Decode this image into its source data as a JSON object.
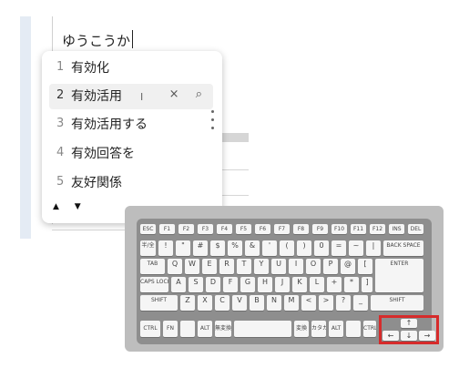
{
  "document": {
    "composition_text": "ゆうこうか"
  },
  "candidate_window": {
    "candidates": [
      {
        "number": "1",
        "text": "有効化"
      },
      {
        "number": "2",
        "text": "有効活用",
        "selected": true
      },
      {
        "number": "3",
        "text": "有効活用する"
      },
      {
        "number": "4",
        "text": "有効回答を"
      },
      {
        "number": "5",
        "text": "友好関係"
      }
    ],
    "row_actions": {
      "close_icon": "×",
      "search_icon": "⌕"
    },
    "prev_page_icon": "▲",
    "next_page_icon": "▼"
  },
  "keyboard": {
    "row1": [
      "ESC",
      "F1",
      "F2",
      "F3",
      "F4",
      "F5",
      "F6",
      "F7",
      "F8",
      "F9",
      "F10",
      "F11",
      "F12",
      "INS",
      "DEL"
    ],
    "row2": [
      "半/全",
      "!",
      "\"",
      "#",
      "$",
      "%",
      "&",
      "'",
      "(",
      ")",
      "0",
      "=",
      "~",
      "|",
      "BACK SPACE"
    ],
    "row3": [
      "TAB",
      "Q",
      "W",
      "E",
      "R",
      "T",
      "Y",
      "U",
      "I",
      "O",
      "P",
      "@",
      "[",
      "ENTER"
    ],
    "row4": [
      "CAPS LOCK",
      "A",
      "S",
      "D",
      "F",
      "G",
      "H",
      "J",
      "K",
      "L",
      "+",
      "*",
      "]"
    ],
    "row5": [
      "SHIFT",
      "Z",
      "X",
      "C",
      "V",
      "B",
      "N",
      "M",
      "<",
      ">",
      "?",
      "_",
      "SHIFT"
    ],
    "row6": [
      "CTRL",
      "FN",
      "",
      "ALT",
      "無変換",
      "",
      "変換",
      "カタカナ",
      "ALT",
      "",
      "CTRL"
    ],
    "arrows": {
      "up": "↑",
      "left": "←",
      "down": "↓",
      "right": "→"
    },
    "highlight_color": "#d62b2b"
  }
}
